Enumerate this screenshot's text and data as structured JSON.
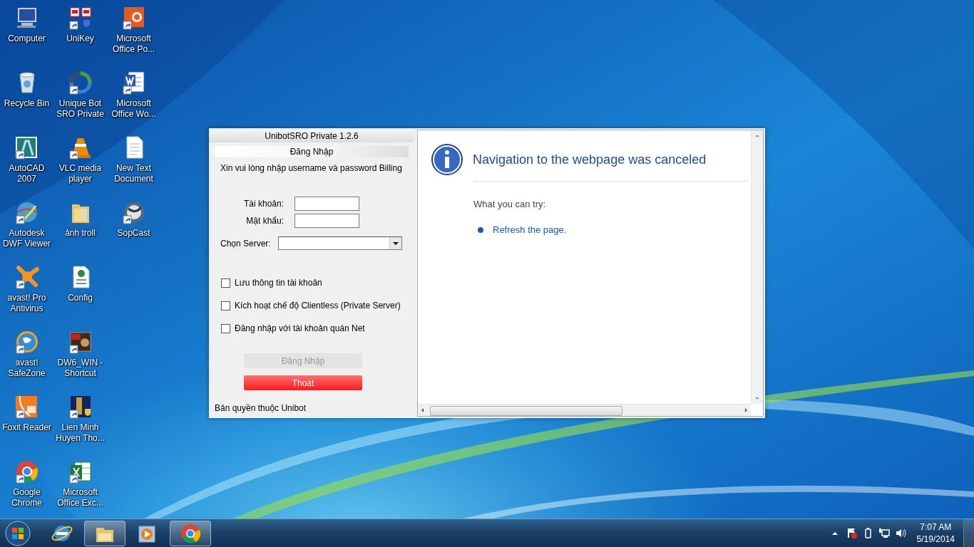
{
  "desktop_icons": [
    {
      "label": "Computer",
      "kind": "computer",
      "shortcut": false
    },
    {
      "label": "Recycle Bin",
      "kind": "recycle-bin",
      "shortcut": false
    },
    {
      "label": "AutoCAD 2007",
      "kind": "cad",
      "shortcut": true
    },
    {
      "label": "Autodesk DWF Viewer",
      "kind": "globe",
      "shortcut": true
    },
    {
      "label": "avast! Pro Antivirus",
      "kind": "splat",
      "shortcut": true
    },
    {
      "label": "avast! SafeZone",
      "kind": "ring-globe",
      "shortcut": true
    },
    {
      "label": "Foxit Reader",
      "kind": "pdf",
      "shortcut": true
    },
    {
      "label": "Google Chrome",
      "kind": "chrome",
      "shortcut": true
    },
    {
      "label": "UniKey",
      "kind": "keys",
      "shortcut": true
    },
    {
      "label": "Unique Bot SRO Private",
      "kind": "bot",
      "shortcut": true
    },
    {
      "label": "VLC media player",
      "kind": "cone",
      "shortcut": true
    },
    {
      "label": "ảnh troll",
      "kind": "folder",
      "shortcut": false
    },
    {
      "label": "Config",
      "kind": "web-doc",
      "shortcut": false
    },
    {
      "label": "DW6_WIN - Shortcut",
      "kind": "game",
      "shortcut": true
    },
    {
      "label": "Lien Minh Huyen Tho...",
      "kind": "game-shield",
      "shortcut": true
    },
    {
      "label": "Microsoft Office Exc...",
      "kind": "spreadsheet",
      "shortcut": true
    },
    {
      "label": "Microsoft Office Po...",
      "kind": "presentation",
      "shortcut": true
    },
    {
      "label": "Microsoft Office Wo...",
      "kind": "word",
      "shortcut": true
    },
    {
      "label": "New Text Document",
      "kind": "text-doc",
      "shortcut": false
    },
    {
      "label": "SopCast",
      "kind": "sphere",
      "shortcut": true
    }
  ],
  "login_window": {
    "title": "UnibotSRO Private 1.2.6",
    "tab": "Đăng Nhập",
    "instruction": "Xin vui lòng nhập username và password Billing",
    "fields": [
      {
        "label": "Tài khoản:"
      },
      {
        "label": "Mật khẩu:"
      }
    ],
    "server_label": "Chọn Server:",
    "checkboxes": [
      {
        "label": "Lưu thông tin tài khoản",
        "checked": false
      },
      {
        "label": "Kích hoạt chế độ Clientless (Private Server)",
        "checked": false
      },
      {
        "label": "Đăng nhập với tài khoản quán Net",
        "checked": false
      }
    ],
    "buttons": [
      {
        "label": "Đăng Nhập",
        "kind": "login",
        "disabled": true
      },
      {
        "label": "Thoát",
        "kind": "exit",
        "disabled": false
      }
    ],
    "footer": "Bản quyền thuộc Unibot"
  },
  "error_page": {
    "heading": "Navigation to the webpage was canceled",
    "subheading": "What you can try:",
    "links": [
      "Refresh the page."
    ]
  },
  "taskbar": {
    "items": [
      {
        "kind": "ie",
        "open": false
      },
      {
        "kind": "explorer",
        "open": true
      },
      {
        "kind": "media",
        "open": false
      },
      {
        "kind": "chrome",
        "open": true
      }
    ],
    "time": "7:07 AM",
    "date": "5/19/2014"
  }
}
